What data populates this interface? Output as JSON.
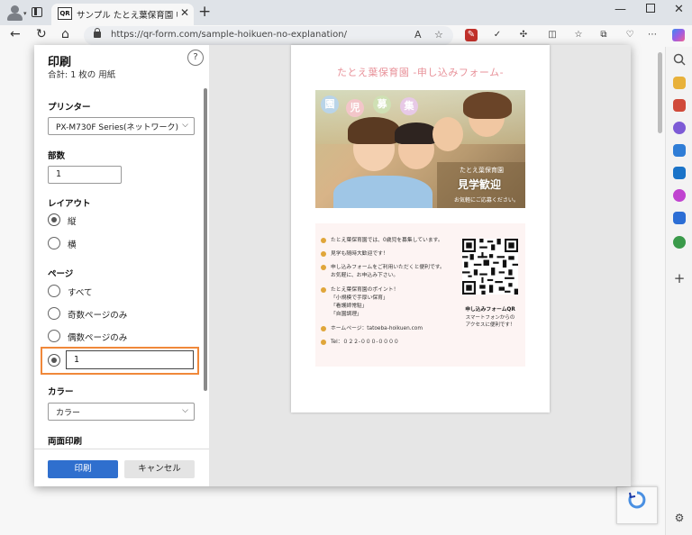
{
  "browser": {
    "tab_title": "サンプル たとえ葉保育園 申し込み",
    "tab_favicon": "QR",
    "url": "https://qr-form.com/sample-hoikuen-no-explanation/",
    "reader_icon": "A",
    "accent_color": "#2f6fce"
  },
  "print_dialog": {
    "title": "印刷",
    "subtitle": "合計: 1 枚の 用紙",
    "help": "?",
    "printer": {
      "label": "プリンター",
      "value": "PX-M730F Series(ネットワーク)"
    },
    "copies": {
      "label": "部数",
      "value": "1"
    },
    "layout": {
      "label": "レイアウト",
      "options": [
        {
          "label": "縦",
          "selected": true
        },
        {
          "label": "横",
          "selected": false
        }
      ]
    },
    "pages": {
      "label": "ページ",
      "options": [
        {
          "label": "すべて",
          "selected": false
        },
        {
          "label": "奇数ページのみ",
          "selected": false
        },
        {
          "label": "偶数ページのみ",
          "selected": false
        }
      ],
      "custom_value": "1",
      "custom_selected": true
    },
    "color": {
      "label": "カラー",
      "value": "カラー"
    },
    "duplex": {
      "label": "両面印刷"
    },
    "print_button": "印刷",
    "cancel_button": "キャンセル",
    "highlight_color": "#f0883a"
  },
  "preview": {
    "title": "たとえ葉保育園 -申し込みフォーム-",
    "banner_chars": [
      "園",
      "児",
      "募",
      "集"
    ],
    "banner_colors": [
      "#b9d4e8",
      "#f3c6c9",
      "#cfe0b4",
      "#e7c9e6"
    ],
    "photo_caption_small": "たとえ葉保育園",
    "photo_caption_large": "見学歓迎",
    "photo_caption_note": "お気軽にご応募ください。",
    "info_items": [
      "たとえ葉保育園では、0歳児を募集しています。",
      "見学も随時大歓迎です！",
      "申し込みフォームをご利用いただくと便利です。",
      "お気軽に、お申込み下さい。",
      "たとえ葉保育園のポイント！",
      "「小規模で手厚い保育」",
      "「看護師常駐」",
      "「自園調理」",
      "ホームページ：tatoeba-hoikuen.com",
      "Tel：０２２-０００-００００"
    ],
    "qr_label": "申し込みフォームQR",
    "qr_desc_1": "スマートフォンからの",
    "qr_desc_2": "アクセスに便利です！"
  }
}
